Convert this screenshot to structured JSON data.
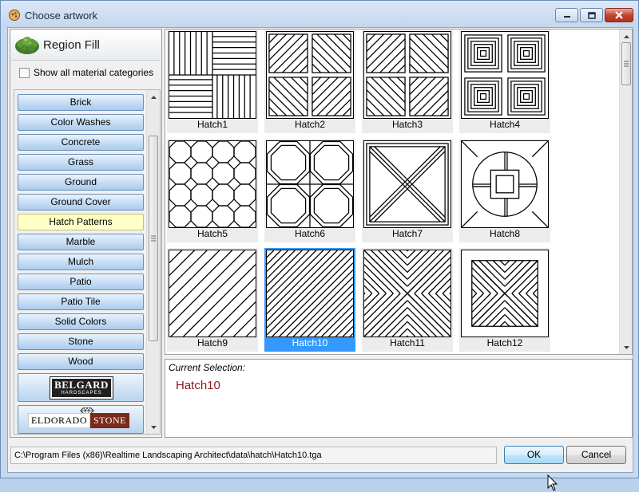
{
  "window": {
    "title": "Choose artwork",
    "caption_buttons": [
      "minimize-icon",
      "maximize-icon",
      "close-icon"
    ]
  },
  "panel": {
    "title": "Region Fill",
    "show_all_label": "Show all material categories",
    "show_all_checked": false
  },
  "categories": [
    {
      "label": "Brick",
      "selected": false
    },
    {
      "label": "Color Washes",
      "selected": false
    },
    {
      "label": "Concrete",
      "selected": false
    },
    {
      "label": "Grass",
      "selected": false
    },
    {
      "label": "Ground",
      "selected": false
    },
    {
      "label": "Ground Cover",
      "selected": false
    },
    {
      "label": "Hatch Patterns",
      "selected": true
    },
    {
      "label": "Marble",
      "selected": false
    },
    {
      "label": "Mulch",
      "selected": false
    },
    {
      "label": "Patio",
      "selected": false
    },
    {
      "label": "Patio Tile",
      "selected": false
    },
    {
      "label": "Solid Colors",
      "selected": false
    },
    {
      "label": "Stone",
      "selected": false
    },
    {
      "label": "Wood",
      "selected": false
    }
  ],
  "brands": {
    "belgard_main": "BELGARD",
    "belgard_sub": "HARDSCAPES",
    "eldorado_left": "ELDORADO",
    "eldorado_right": "STONE"
  },
  "artworks": [
    {
      "label": "Hatch1",
      "pattern": "basketweave"
    },
    {
      "label": "Hatch2",
      "pattern": "diagonal-quads"
    },
    {
      "label": "Hatch3",
      "pattern": "diagonal-quads-alt"
    },
    {
      "label": "Hatch4",
      "pattern": "square-spirals"
    },
    {
      "label": "Hatch5",
      "pattern": "octagon-small"
    },
    {
      "label": "Hatch6",
      "pattern": "octagon-large"
    },
    {
      "label": "Hatch7",
      "pattern": "x-frame"
    },
    {
      "label": "Hatch8",
      "pattern": "circle-square"
    },
    {
      "label": "Hatch9",
      "pattern": "diagonal-wide"
    },
    {
      "label": "Hatch10",
      "pattern": "diagonal-dense"
    },
    {
      "label": "Hatch11",
      "pattern": "chevron-x"
    },
    {
      "label": "Hatch12",
      "pattern": "framed-x"
    }
  ],
  "selected_artwork": "Hatch10",
  "selection": {
    "label": "Current Selection:",
    "value": "Hatch10"
  },
  "path": "C:\\Program Files (x86)\\Realtime Landscaping Architect\\data\\hatch\\Hatch10.tga",
  "buttons": {
    "ok": "OK",
    "cancel": "Cancel"
  },
  "colors": {
    "selected_tile": "#3399ff",
    "selected_category": "#ffffc8",
    "selection_text": "#8b1a1a"
  }
}
